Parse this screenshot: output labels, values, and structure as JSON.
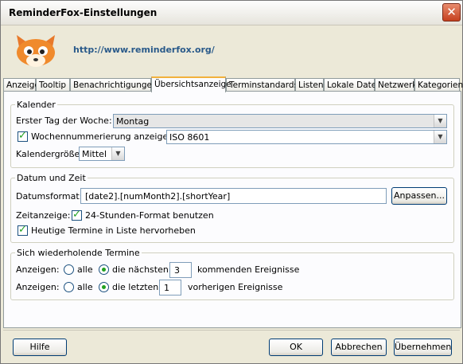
{
  "window": {
    "title": "ReminderFox-Einstellungen",
    "close_glyph": "✕"
  },
  "header": {
    "url": "http://www.reminderfox.org/",
    "logo_icon": "fox-logo-icon"
  },
  "tabs": [
    {
      "label": "Anzeige",
      "active": false
    },
    {
      "label": "Tooltip",
      "active": false
    },
    {
      "label": "Benachrichtigungen",
      "active": false
    },
    {
      "label": "Übersichtsanzeige",
      "active": true
    },
    {
      "label": "Terminstandards",
      "active": false
    },
    {
      "label": "Listen",
      "active": false
    },
    {
      "label": "Lokale Datei",
      "active": false
    },
    {
      "label": "Netzwerk",
      "active": false
    },
    {
      "label": "Kategorien",
      "active": false
    }
  ],
  "kalender": {
    "legend": "Kalender",
    "first_day_label": "Erster Tag der Woche:",
    "first_day_value": "Montag",
    "week_number_label": "Wochennummerierung anzeigen",
    "week_number_checked": true,
    "week_number_value": "ISO 8601",
    "size_label": "Kalendergröße",
    "size_value": "Mittel"
  },
  "datum": {
    "legend": "Datum und Zeit",
    "format_label": "Datumsformat:",
    "format_value": "[date2].[numMonth2].[shortYear]",
    "customize_button": "Anpassen...",
    "time_label": "Zeitanzeige:",
    "time_24h_label": "24-Stunden-Format benutzen",
    "time_24h_checked": true,
    "highlight_label": "Heutige Termine in Liste hervorheben",
    "highlight_checked": true
  },
  "wiederholend": {
    "legend": "Sich wiederholende Termine",
    "rows": [
      {
        "show_label": "Anzeigen:",
        "all_label": "alle",
        "next_label": "die nächsten",
        "count": "3",
        "suffix": "kommenden Ereignisse",
        "selected": "next"
      },
      {
        "show_label": "Anzeigen:",
        "all_label": "alle",
        "next_label": "die letzten",
        "count": "1",
        "suffix": "vorherigen Ereignisse",
        "selected": "next"
      }
    ]
  },
  "footer": {
    "help": "Hilfe",
    "ok": "OK",
    "cancel": "Abbrechen",
    "apply": "Übernehmen"
  },
  "colors": {
    "accent": "#21a121",
    "url": "#2a5a8a",
    "active_tab_border": "#f2b13c"
  }
}
